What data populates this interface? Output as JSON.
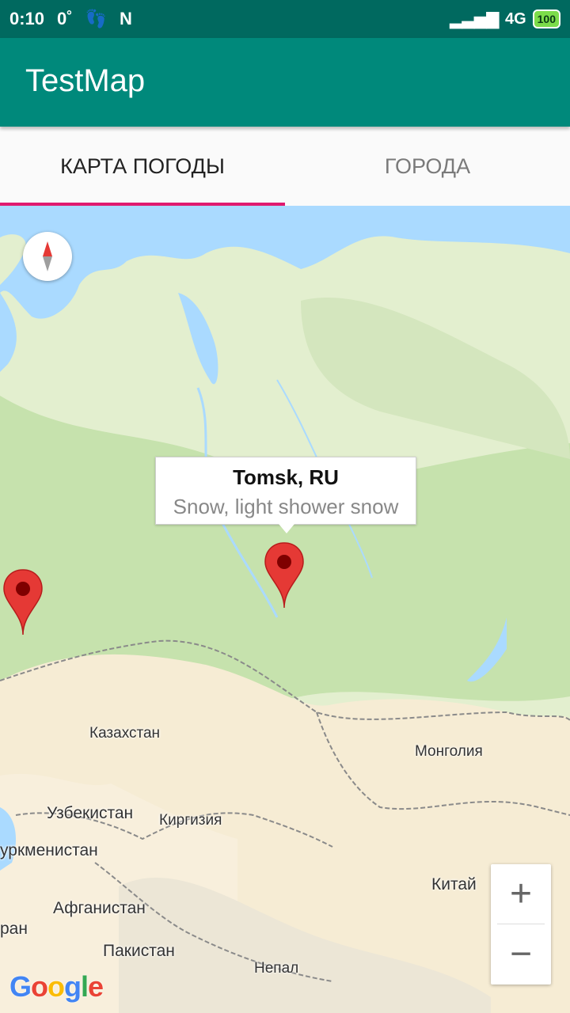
{
  "statusbar": {
    "time": "0:10",
    "temp": "0˚",
    "network": "4G",
    "battery": "100"
  },
  "appbar": {
    "title": "TestMap"
  },
  "tabs": [
    {
      "label": "КАРТА ПОГОДЫ",
      "active": true
    },
    {
      "label": "ГОРОДА",
      "active": false
    }
  ],
  "map": {
    "infowindow": {
      "title": "Tomsk, RU",
      "snippet": "Snow, light shower snow"
    },
    "labels": {
      "kazakhstan": "Казахстан",
      "mongolia": "Монголия",
      "uzbekistan": "Узбекистан",
      "kyrgyzstan": "Киргизия",
      "turkmenistan": "уркменистан",
      "china": "Китай",
      "afghanistan": "Афганистан",
      "iran": "ран",
      "pakistan": "Пакистан",
      "nepal": "Непал"
    },
    "zoom_in": "+",
    "zoom_out": "−",
    "google_logo": "Google",
    "colors": {
      "water": "#aadaff",
      "land": "#e3efcf",
      "forest": "#c6e2ad",
      "desert": "#f6ecd4",
      "marker": "#e53935"
    }
  }
}
